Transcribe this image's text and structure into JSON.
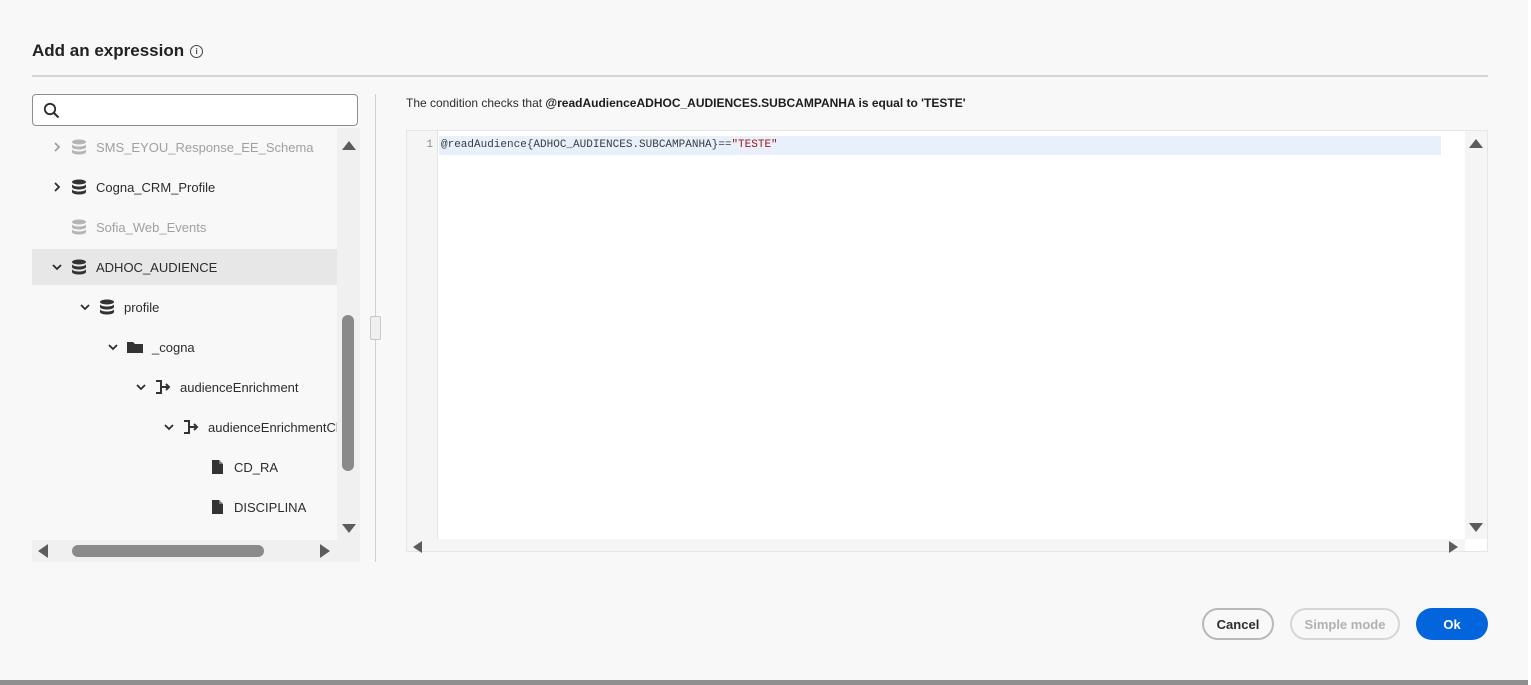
{
  "dialog": {
    "title": "Add an expression"
  },
  "search": {
    "placeholder": "",
    "value": ""
  },
  "tree": {
    "items": [
      {
        "label": "SMS_EYOU_Response_EE_Schema",
        "icon": "database-icon",
        "expanded": false,
        "dim": true
      },
      {
        "label": "Cogna_CRM_Profile",
        "icon": "database-icon",
        "expanded": false,
        "dim": false
      },
      {
        "label": "Sofia_Web_Events",
        "icon": "database-icon",
        "expanded": null,
        "dim": true
      },
      {
        "label": "ADHOC_AUDIENCE",
        "icon": "database-icon",
        "expanded": true,
        "selected": true
      },
      {
        "label": "profile",
        "icon": "database-icon",
        "expanded": true
      },
      {
        "label": "_cogna",
        "icon": "folder-icon",
        "expanded": true
      },
      {
        "label": "audienceEnrichment",
        "icon": "object-icon",
        "expanded": true
      },
      {
        "label": "audienceEnrichmentCh",
        "icon": "object-icon",
        "expanded": true
      },
      {
        "label": "CD_RA",
        "icon": "file-icon",
        "expanded": null
      },
      {
        "label": "DISCIPLINA",
        "icon": "file-icon",
        "expanded": null
      }
    ]
  },
  "condition": {
    "prefix": "The condition checks that ",
    "expression": "@readAudienceADHOC_AUDIENCES.SUBCAMPANHA is equal to 'TESTE'"
  },
  "editor": {
    "line_number": "1",
    "code_prefix": "@readAudience{ADHOC_AUDIENCES.SUBCAMPANHA}==",
    "code_string": "\"TESTE\""
  },
  "buttons": {
    "cancel": "Cancel",
    "simple_mode": "Simple mode",
    "ok": "Ok"
  },
  "colors": {
    "accent": "#0265dc",
    "selected_row": "#e7e7e7",
    "string": "#a31515"
  }
}
